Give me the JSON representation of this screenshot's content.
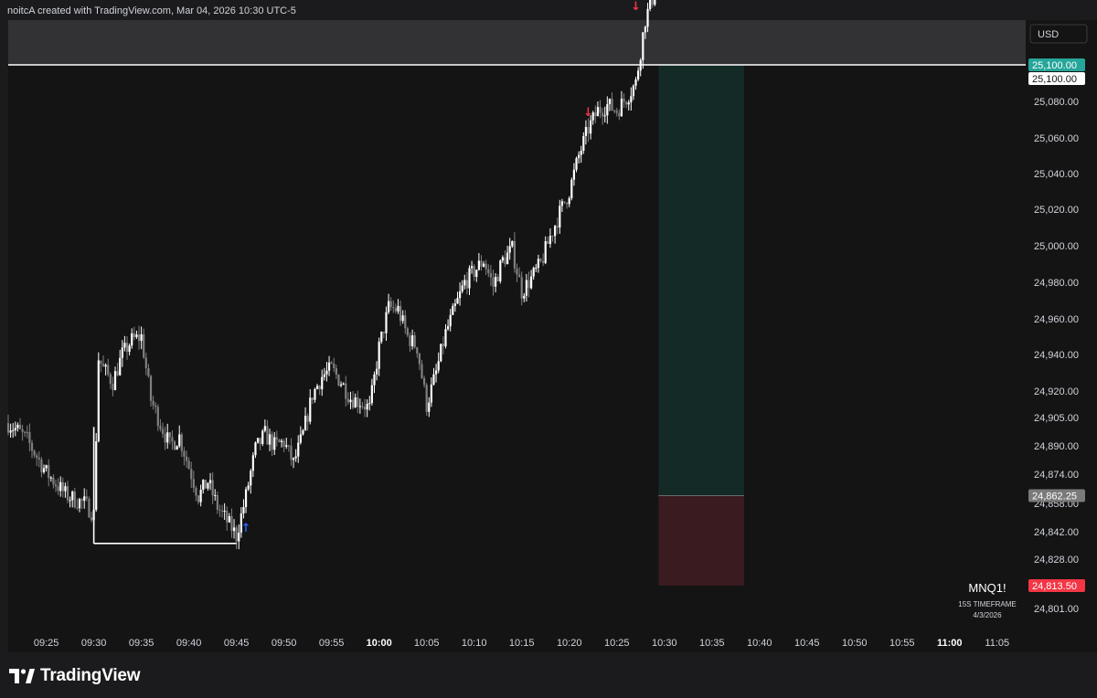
{
  "header": {
    "caption": "noitcA created with TradingView.com, Mar 04, 2026 10:30 UTC-5"
  },
  "currency_label": "USD",
  "symbol": {
    "name": "MNQ1!",
    "timeframe": "15S TIMEFRAME",
    "date": "4/3/2026"
  },
  "brand": {
    "name": "TradingView"
  },
  "colors": {
    "background": "#141414",
    "frame": "#1b1b1d",
    "candle_up": "#ffffff",
    "candle_down": "#808080",
    "target_zone": "#132a26",
    "stop_zone": "#3a1b1f",
    "badge_green": "#26a69a",
    "badge_red": "#f23645",
    "badge_gray": "#7a7a7a",
    "arrow_up": "#2962ff",
    "arrow_down": "#f23645"
  },
  "chart_data": {
    "type": "candlestick",
    "title": "",
    "xlabel": "",
    "ylabel": "",
    "x_ticks": [
      "09:25",
      "09:30",
      "09:35",
      "09:40",
      "09:45",
      "09:50",
      "09:55",
      "10:00",
      "10:05",
      "10:10",
      "10:15",
      "10:20",
      "10:25",
      "10:30",
      "10:35",
      "10:40",
      "10:45",
      "10:50",
      "10:55",
      "11:00",
      "11:05"
    ],
    "x_ticks_bold": [
      "10:00",
      "11:00"
    ],
    "y_ticks": [
      25080,
      25060,
      25040,
      25020,
      25000,
      24980,
      24960,
      24940,
      24920,
      24905,
      24890,
      24874,
      24858,
      24842,
      24828,
      24801
    ],
    "y_tick_labels": [
      "25,080.00",
      "25,060.00",
      "25,040.00",
      "25,020.00",
      "25,000.00",
      "24,980.00",
      "24,960.00",
      "24,940.00",
      "24,920.00",
      "24,905.00",
      "24,890.00",
      "24,874.00",
      "24,858.00",
      "24,842.00",
      "24,828.00",
      "24,801.00"
    ],
    "x_range": [
      "09:21",
      "11:08"
    ],
    "y_range": [
      24787,
      25144
    ],
    "price_path": [
      [
        "09:21",
        24902
      ],
      [
        "09:22",
        24898
      ],
      [
        "09:23",
        24893
      ],
      [
        "09:24",
        24884
      ],
      [
        "09:25",
        24875
      ],
      [
        "09:26",
        24869
      ],
      [
        "09:27",
        24863
      ],
      [
        "09:28",
        24860
      ],
      [
        "09:29",
        24858
      ],
      [
        "09:30",
        24852
      ],
      [
        "09:30.5",
        24938
      ],
      [
        "09:31",
        24932
      ],
      [
        "09:32",
        24925
      ],
      [
        "09:33",
        24940
      ],
      [
        "09:34",
        24948
      ],
      [
        "09:35",
        24950
      ],
      [
        "09:36",
        24915
      ],
      [
        "09:37",
        24902
      ],
      [
        "09:38",
        24890
      ],
      [
        "09:39",
        24895
      ],
      [
        "09:40",
        24878
      ],
      [
        "09:41",
        24862
      ],
      [
        "09:42",
        24870
      ],
      [
        "09:43",
        24856
      ],
      [
        "09:44",
        24848
      ],
      [
        "09:45",
        24840
      ],
      [
        "09:46",
        24862
      ],
      [
        "09:47",
        24888
      ],
      [
        "09:48",
        24896
      ],
      [
        "09:49",
        24890
      ],
      [
        "09:50",
        24892
      ],
      [
        "09:51",
        24880
      ],
      [
        "09:52",
        24896
      ],
      [
        "09:53",
        24918
      ],
      [
        "09:54",
        24928
      ],
      [
        "09:55",
        24932
      ],
      [
        "09:56",
        24925
      ],
      [
        "09:57",
        24916
      ],
      [
        "09:58",
        24914
      ],
      [
        "09:59",
        24910
      ],
      [
        "10:00",
        24944
      ],
      [
        "10:01",
        24966
      ],
      [
        "10:02",
        24965
      ],
      [
        "10:03",
        24950
      ],
      [
        "10:04",
        24944
      ],
      [
        "10:05",
        24912
      ],
      [
        "10:06",
        24930
      ],
      [
        "10:07",
        24952
      ],
      [
        "10:08",
        24966
      ],
      [
        "10:09",
        24980
      ],
      [
        "10:10",
        24986
      ],
      [
        "10:11",
        24992
      ],
      [
        "10:12",
        24978
      ],
      [
        "10:13",
        24992
      ],
      [
        "10:14",
        24998
      ],
      [
        "10:15",
        24975
      ],
      [
        "10:16",
        24982
      ],
      [
        "10:17",
        24990
      ],
      [
        "10:18",
        25005
      ],
      [
        "10:19",
        25018
      ],
      [
        "10:20",
        25030
      ],
      [
        "10:21",
        25050
      ],
      [
        "10:22",
        25065
      ],
      [
        "10:23",
        25075
      ],
      [
        "10:24",
        25078
      ],
      [
        "10:25",
        25075
      ],
      [
        "10:26",
        25082
      ],
      [
        "10:27",
        25090
      ],
      [
        "10:28",
        25125
      ],
      [
        "10:29",
        25140
      ],
      [
        "10:30",
        25144
      ]
    ],
    "levels": [
      {
        "price": 25100.0,
        "label": "25,100.00",
        "badge": "green"
      },
      {
        "price": 25100.0,
        "label": "25,100.00",
        "badge": "white"
      },
      {
        "price": 24862.25,
        "label": "24,862.25",
        "badge": "gray"
      },
      {
        "price": 24813.5,
        "label": "24,813.50",
        "badge": "red"
      }
    ],
    "position": {
      "entry": 24862.25,
      "target": 25100.0,
      "stop": 24813.5,
      "start_time": "10:29",
      "end_time": "10:38"
    },
    "horizontal_lines": [
      {
        "price": 25100.0,
        "from": "09:21",
        "to": "11:08"
      },
      {
        "price": 24836,
        "from": "09:30",
        "to": "09:45"
      }
    ],
    "vertical_lines": [
      {
        "time": "09:30",
        "from": 24836,
        "to": 24900
      }
    ],
    "markers": [
      {
        "time": "09:46",
        "price": 24842,
        "direction": "up"
      },
      {
        "time": "10:22",
        "price": 25072,
        "direction": "down"
      },
      {
        "time": "10:27",
        "price": 25130,
        "direction": "down"
      }
    ],
    "highlight_band": {
      "from": 25100.0,
      "to": 25144
    }
  }
}
